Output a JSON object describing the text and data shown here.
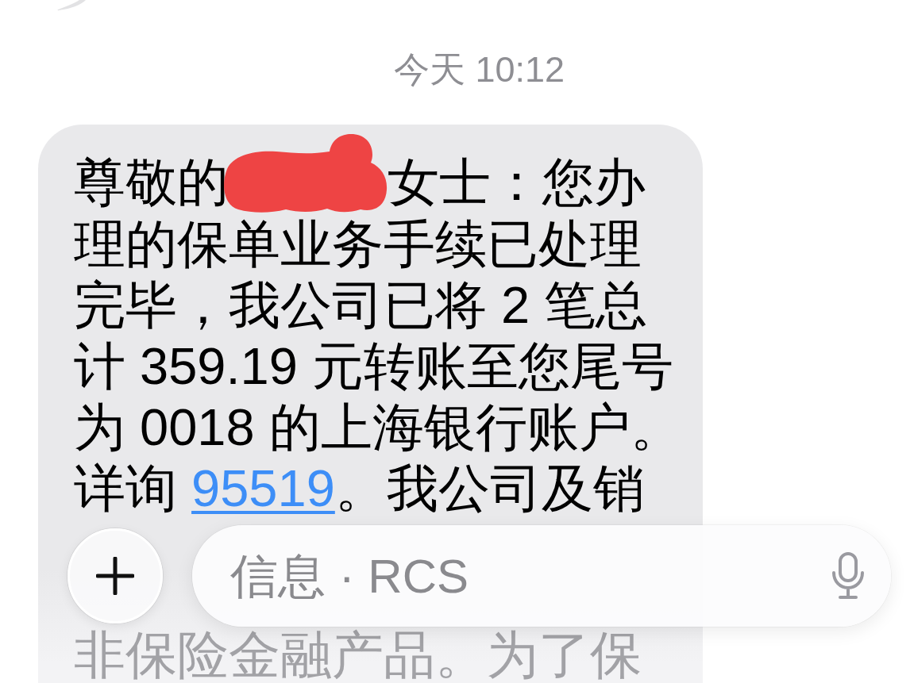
{
  "timestamp": "今天 10:12",
  "message": {
    "lines": [
      [
        {
          "kind": "text",
          "text": "尊敬的"
        },
        {
          "kind": "redaction"
        },
        {
          "kind": "text",
          "text": "女士：您办"
        }
      ],
      [
        {
          "kind": "text",
          "text": "理的保单业务手续已处理"
        }
      ],
      [
        {
          "kind": "text",
          "text": "完毕，我公司已将 2 笔总"
        }
      ],
      [
        {
          "kind": "text",
          "text": "计 359.19 元转账至您尾号"
        }
      ],
      [
        {
          "kind": "text",
          "text": "为 0018 的上海银行账户。"
        }
      ],
      [
        {
          "kind": "text",
          "text": "详询 "
        },
        {
          "kind": "link",
          "text": "95519"
        },
        {
          "kind": "text",
          "text": "。我公司及销"
        }
      ]
    ],
    "lines_below_input": [
      [
        {
          "kind": "text",
          "text": "非保险金融产品。为了保"
        }
      ]
    ]
  },
  "composer": {
    "placeholder": "信息 · RCS"
  }
}
